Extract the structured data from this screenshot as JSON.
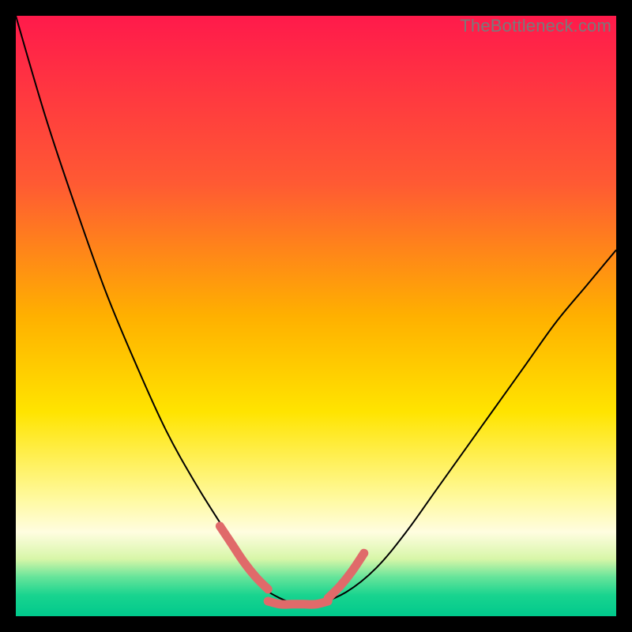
{
  "watermark": "TheBottleneck.com",
  "chart_data": {
    "type": "line",
    "title": "",
    "xlabel": "",
    "ylabel": "",
    "xlim": [
      0,
      100
    ],
    "ylim": [
      0,
      100
    ],
    "grid": false,
    "legend": false,
    "gradient_stops": [
      {
        "offset": 0.0,
        "color": "#ff1a4b"
      },
      {
        "offset": 0.28,
        "color": "#ff5a33"
      },
      {
        "offset": 0.5,
        "color": "#ffb000"
      },
      {
        "offset": 0.66,
        "color": "#ffe400"
      },
      {
        "offset": 0.8,
        "color": "#fff99a"
      },
      {
        "offset": 0.86,
        "color": "#fffde0"
      },
      {
        "offset": 0.905,
        "color": "#d7f6a8"
      },
      {
        "offset": 0.935,
        "color": "#66e49a"
      },
      {
        "offset": 0.965,
        "color": "#19d48f"
      },
      {
        "offset": 1.0,
        "color": "#00c98c"
      }
    ],
    "series": [
      {
        "name": "curve",
        "stroke": "#000000",
        "stroke_width": 2,
        "x": [
          0,
          5,
          10,
          15,
          20,
          25,
          30,
          35,
          38,
          41,
          44,
          47,
          50,
          55,
          60,
          65,
          70,
          75,
          80,
          85,
          90,
          95,
          100
        ],
        "y": [
          100,
          83,
          68,
          54,
          42,
          31,
          22,
          14,
          9,
          5,
          3,
          2,
          2,
          4,
          8,
          14,
          21,
          28,
          35,
          42,
          49,
          55,
          61
        ]
      },
      {
        "name": "highlight-left",
        "stroke": "#e06a6a",
        "stroke_width": 11,
        "linecap": "round",
        "x": [
          34,
          36,
          38,
          40,
          42
        ],
        "y": [
          15,
          12,
          9,
          6.5,
          4.5
        ]
      },
      {
        "name": "highlight-bottom",
        "stroke": "#e06a6a",
        "stroke_width": 11,
        "linecap": "round",
        "x": [
          42,
          44,
          46,
          48,
          50,
          52
        ],
        "y": [
          2.5,
          2,
          2,
          2,
          2,
          2.5
        ]
      },
      {
        "name": "highlight-right",
        "stroke": "#e06a6a",
        "stroke_width": 11,
        "linecap": "round",
        "x": [
          52,
          54,
          56,
          58
        ],
        "y": [
          3,
          5,
          7.5,
          10.5
        ]
      }
    ]
  }
}
